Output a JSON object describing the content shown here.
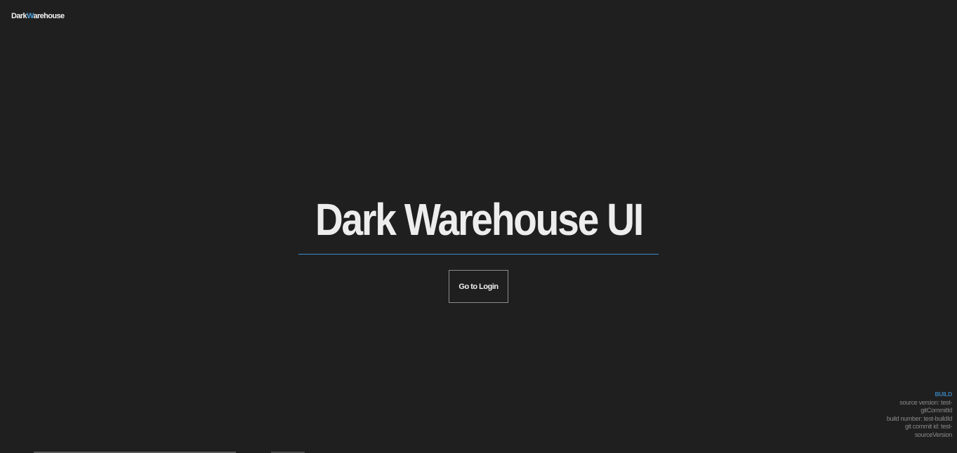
{
  "header": {
    "logo_part1": "Dark",
    "logo_part2": "W",
    "logo_part3": "arehouse"
  },
  "hero": {
    "title": "Dark Warehouse UI",
    "login_button": "Go to Login"
  },
  "build": {
    "title": "BUILD",
    "source_version": "source version: test-gitCommitId",
    "build_number": "build number: test-buildId",
    "git_commit_id": "git commit id: test-sourceVersion"
  },
  "colors": {
    "background": "#1f1f1f",
    "accent": "#4a9fd8",
    "text": "#ececec"
  }
}
